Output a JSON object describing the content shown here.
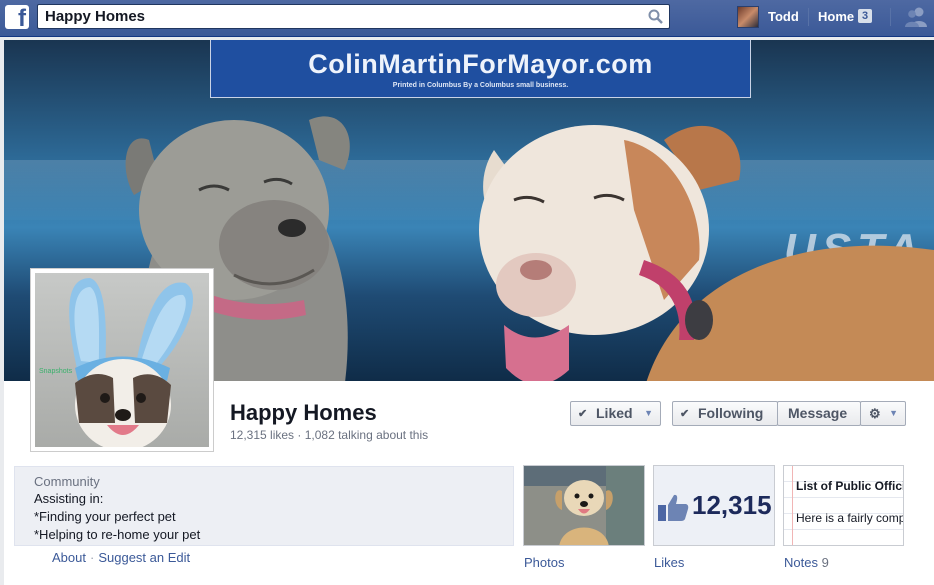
{
  "topbar": {
    "search_value": "Happy Homes",
    "user_name": "Todd",
    "home_label": "Home",
    "home_badge": "3"
  },
  "cover": {
    "banner_title": "ColinMartinForMayor.com",
    "banner_subtitle": "Printed in Columbus  By a Columbus small business.",
    "car_text": "USTA"
  },
  "page": {
    "name": "Happy Homes",
    "stats": "12,315 likes · 1,082 talking about this"
  },
  "actions": {
    "liked_label": "Liked",
    "following_label": "Following",
    "message_label": "Message"
  },
  "about": {
    "category": "Community",
    "lines": [
      "Assisting in:",
      "*Finding your perfect pet",
      "*Helping to re-home your pet"
    ],
    "about_link": "About",
    "suggest_link": "Suggest an Edit"
  },
  "tiles": {
    "photos_label": "Photos",
    "likes_label": "Likes",
    "likes_count": "12,315",
    "notes_label": "Notes",
    "notes_count": "9",
    "notes_title": "List of Public Offici and News People",
    "notes_body": "Here is a fairly comprehensive list"
  },
  "colors": {
    "brand": "#3b5998",
    "link": "#3b5998"
  },
  "icons": {
    "search": "search-icon",
    "friends": "friends-icon",
    "thumbs_up": "thumbs-up-icon",
    "gear": "gear-icon"
  }
}
